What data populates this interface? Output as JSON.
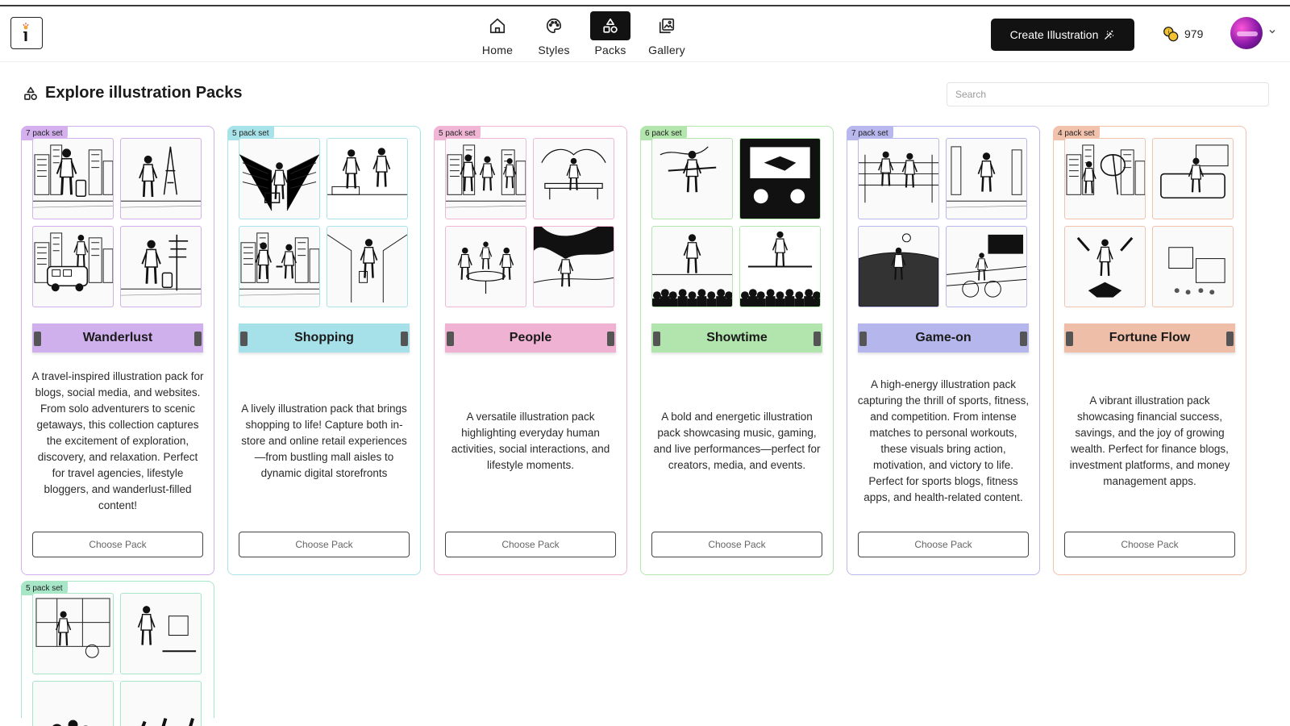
{
  "app": {
    "logo_letter": "i"
  },
  "nav": {
    "items": [
      {
        "label": "Home",
        "icon": "home-icon",
        "active": false
      },
      {
        "label": "Styles",
        "icon": "palette-icon",
        "active": false
      },
      {
        "label": "Packs",
        "icon": "shapes-icon",
        "active": true
      },
      {
        "label": "Gallery",
        "icon": "gallery-icon",
        "active": false
      }
    ]
  },
  "header": {
    "create_label": "Create Illustration",
    "credits": "979"
  },
  "page": {
    "title": "Explore illustration Packs",
    "search_placeholder": "Search"
  },
  "packs": [
    {
      "name": "Wanderlust",
      "badge": "7 pack set",
      "color": "#d4b0ee",
      "ribbon": "#cfb0ec",
      "description": "A travel-inspired illustration pack for blogs, social media, and websites. From solo adventurers to scenic getaways, this collection captures the excitement of exploration, discovery, and relaxation. Perfect for travel agencies, lifestyle bloggers, and wanderlust-filled content!",
      "button": "Choose Pack"
    },
    {
      "name": "Shopping",
      "badge": "5 pack set",
      "color": "#a9e3ea",
      "ribbon": "#a6e0e8",
      "description": "A lively illustration pack that brings shopping to life! Capture both in-store and online retail experiences—from bustling mall aisles to dynamic digital storefronts",
      "button": "Choose Pack"
    },
    {
      "name": "People",
      "badge": "5 pack set",
      "color": "#f1b6d6",
      "ribbon": "#f0b2d3",
      "description": "A versatile illustration pack highlighting everyday human activities, social interactions, and lifestyle moments.",
      "button": "Choose Pack"
    },
    {
      "name": "Showtime",
      "badge": "6 pack set",
      "color": "#b3e6ad",
      "ribbon": "#b2e5ad",
      "description": "A bold and energetic illustration pack showcasing music, gaming, and live performances—perfect for creators, media, and events.",
      "button": "Choose Pack"
    },
    {
      "name": "Game-on",
      "badge": "7 pack set",
      "color": "#b8b8ee",
      "ribbon": "#b5b6ec",
      "description": "A high-energy illustration pack capturing the thrill of sports, fitness, and competition. From intense matches to personal workouts, these visuals bring action, motivation, and victory to life. Perfect for sports blogs, fitness apps, and health-related content.",
      "button": "Choose Pack"
    },
    {
      "name": "Fortune Flow",
      "badge": "4 pack set",
      "color": "#f2c2ad",
      "ribbon": "#efbea9",
      "description": "A vibrant illustration pack showcasing financial success, savings, and the joy of growing wealth. Perfect for finance blogs, investment platforms, and money management apps.",
      "button": "Choose Pack"
    }
  ],
  "partial_pack": {
    "badge": "5 pack set",
    "color": "#a8e6c8"
  }
}
